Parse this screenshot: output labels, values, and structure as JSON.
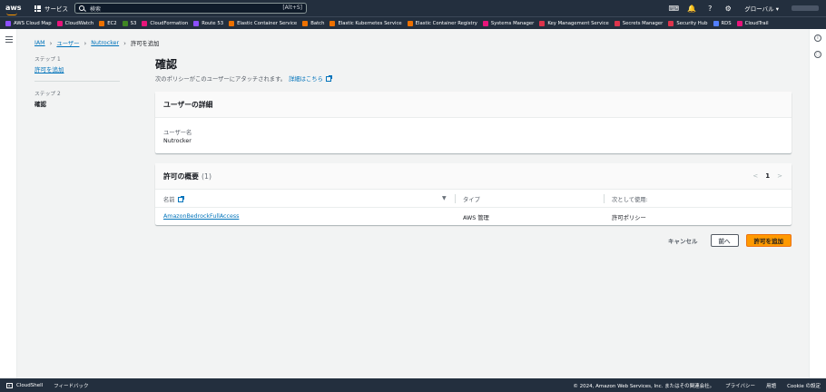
{
  "topnav": {
    "logo": "aws",
    "services_label": "サービス",
    "search_placeholder": "検索",
    "search_shortcut": "[Alt+S]",
    "region_label": "グローバル ▾",
    "icons": [
      "cloudshell-icon",
      "bell-icon",
      "help-icon",
      "gear-icon"
    ]
  },
  "favorites": [
    {
      "label": "AWS Cloud Map",
      "color": "#8c4fff"
    },
    {
      "label": "CloudWatch",
      "color": "#e7157b"
    },
    {
      "label": "EC2",
      "color": "#ed7100"
    },
    {
      "label": "S3",
      "color": "#3f8624"
    },
    {
      "label": "CloudFormation",
      "color": "#e7157b"
    },
    {
      "label": "Route 53",
      "color": "#8c4fff"
    },
    {
      "label": "Elastic Container Service",
      "color": "#ed7100"
    },
    {
      "label": "Batch",
      "color": "#ed7100"
    },
    {
      "label": "Elastic Kubernetes Service",
      "color": "#ed7100"
    },
    {
      "label": "Elastic Container Registry",
      "color": "#ed7100"
    },
    {
      "label": "Systems Manager",
      "color": "#e7157b"
    },
    {
      "label": "Key Management Service",
      "color": "#dd344c"
    },
    {
      "label": "Secrets Manager",
      "color": "#dd344c"
    },
    {
      "label": "Security Hub",
      "color": "#dd344c"
    },
    {
      "label": "RDS",
      "color": "#527fff"
    },
    {
      "label": "CloudTrail",
      "color": "#e7157b"
    }
  ],
  "breadcrumb": {
    "iam": "IAM",
    "users": "ユーザー",
    "user": "Nutrocker",
    "current": "許可を追加"
  },
  "steps": {
    "step1_label": "ステップ 1",
    "step1_link": "許可を追加",
    "step2_label": "ステップ 2",
    "step2_current": "確認"
  },
  "main": {
    "title": "確認",
    "description": "次のポリシーがこのユーザーにアタッチされます。",
    "details_link": "詳細はこちら"
  },
  "user_details": {
    "header": "ユーザーの詳細",
    "username_key": "ユーザー名",
    "username_value": "Nutrocker"
  },
  "permissions": {
    "header": "許可の概要",
    "count": "(1)",
    "page": "1",
    "prev": "<",
    "next": ">",
    "columns": {
      "name": "名前",
      "type": "タイプ",
      "used_as": "次として使用:"
    },
    "rows": [
      {
        "name": "AmazonBedrockFullAccess",
        "type": "AWS 管理",
        "used_as": "許可ポリシー"
      }
    ]
  },
  "actions": {
    "cancel": "キャンセル",
    "previous": "前へ",
    "submit": "許可を追加"
  },
  "footer": {
    "cloudshell": "CloudShell",
    "feedback": "フィードバック",
    "copyright": "© 2024, Amazon Web Services, Inc. またはその関連会社。",
    "privacy": "プライバシー",
    "terms": "用語",
    "cookies": "Cookie の設定"
  }
}
